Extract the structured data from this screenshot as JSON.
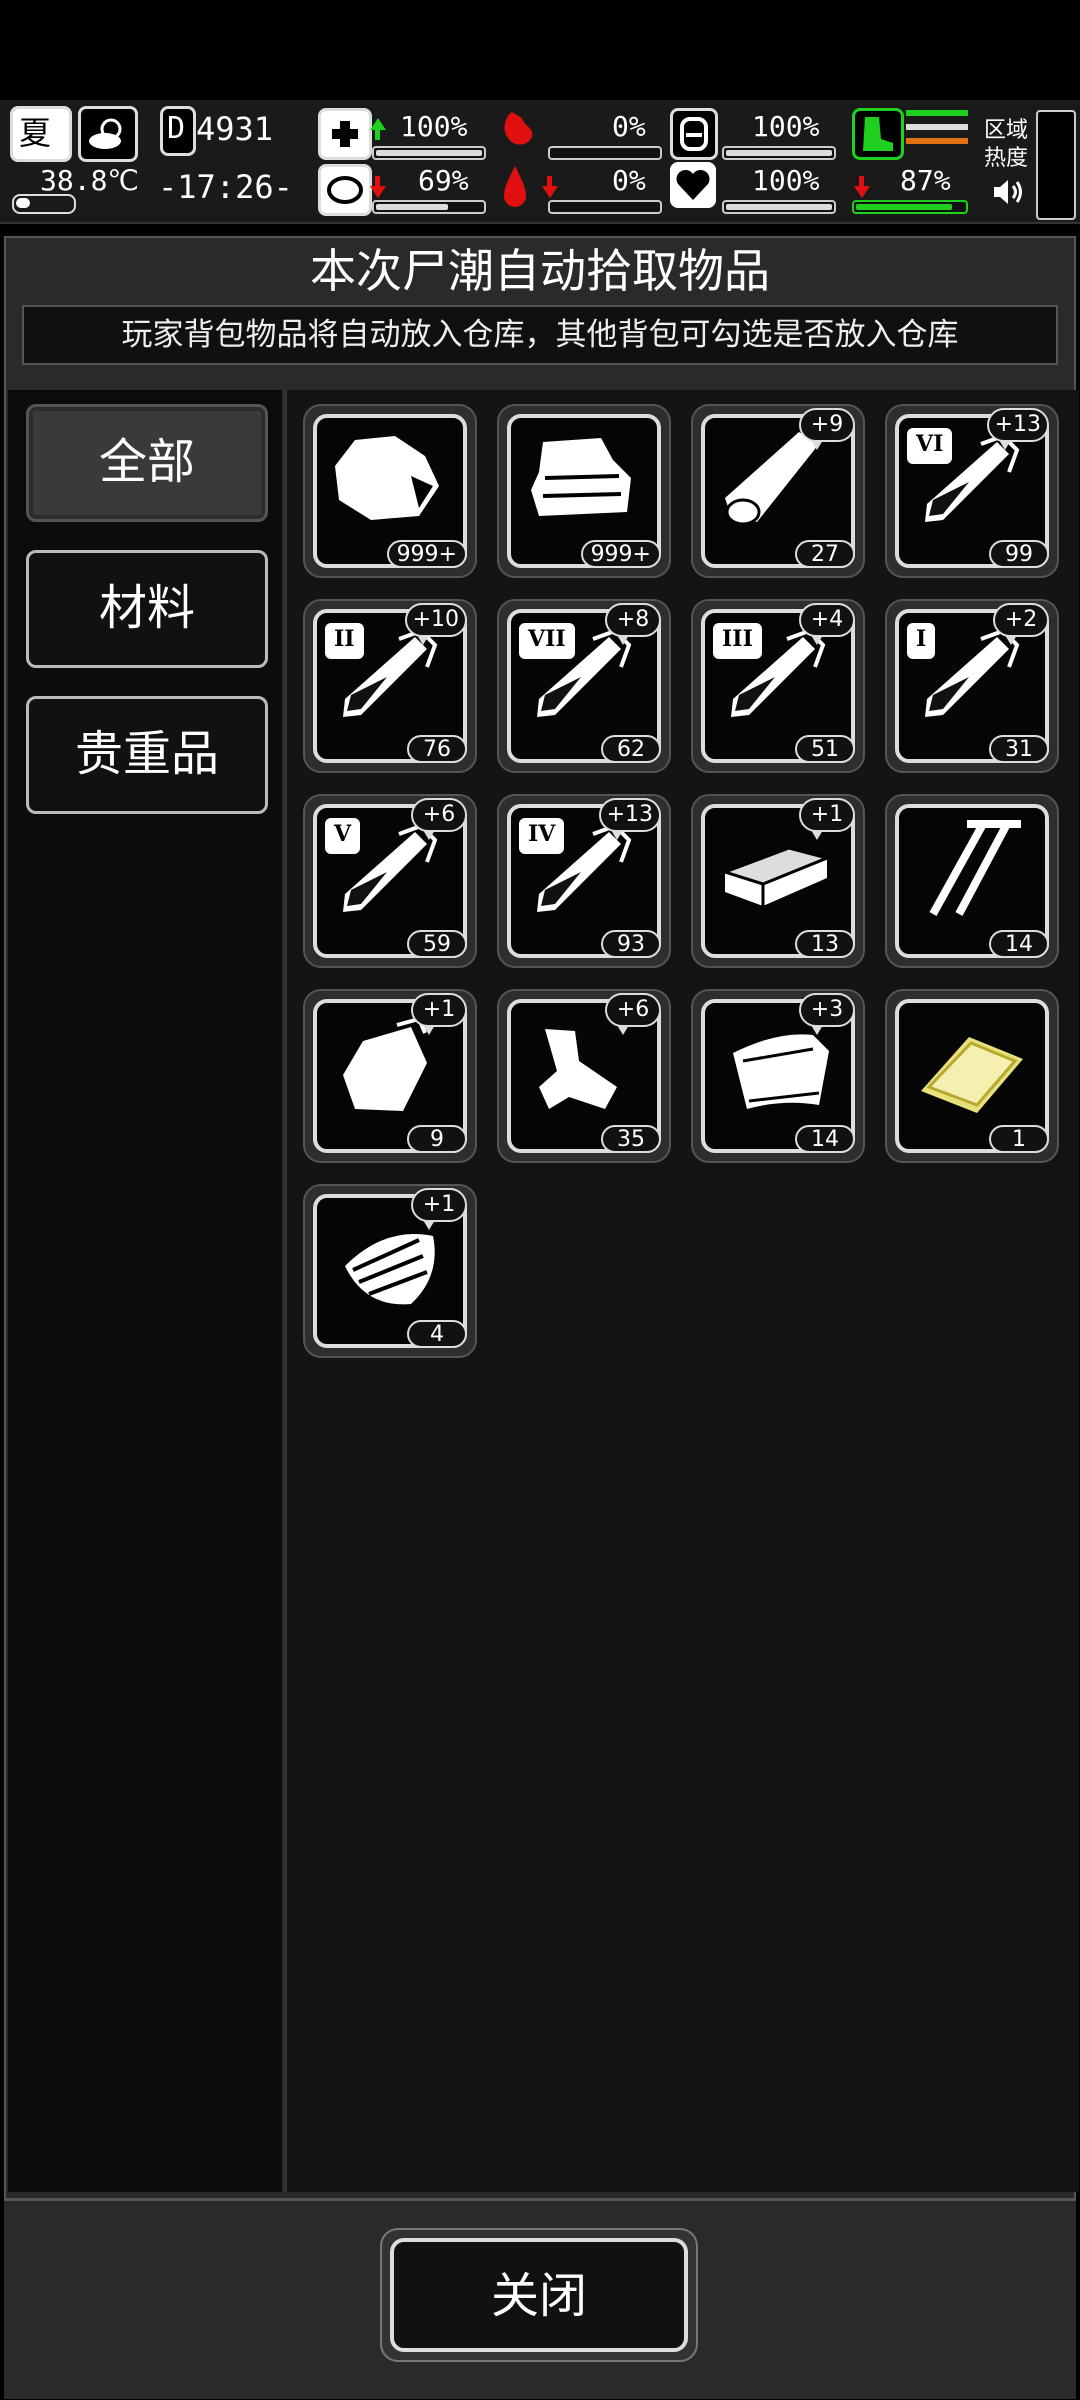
{
  "hud": {
    "season": "夏",
    "temperature": "38.8℃",
    "day": "4931",
    "time": "-17:26-",
    "stats": [
      {
        "name": "health",
        "value": "100%",
        "trend": "up",
        "fill": 1.0
      },
      {
        "name": "hunger",
        "value": "0%",
        "trend": "none",
        "fill": 0.0
      },
      {
        "name": "capacity",
        "value": "100%",
        "trend": "none",
        "fill": 1.0
      },
      {
        "name": "sanity",
        "value": "69%",
        "trend": "down",
        "fill": 0.69
      },
      {
        "name": "thirst",
        "value": "0%",
        "trend": "down",
        "fill": 0.0
      },
      {
        "name": "mood",
        "value": "100%",
        "trend": "none",
        "fill": 1.0
      },
      {
        "name": "stamina",
        "value": "87%",
        "trend": "down",
        "fill": 0.87
      }
    ],
    "area_label_1": "区域",
    "area_label_2": "热度"
  },
  "panel": {
    "title": "本次尸潮自动拾取物品",
    "subtitle": "玩家背包物品将自动放入仓库，其他背包可勾选是否放入仓库"
  },
  "tabs": [
    {
      "label": "全部",
      "active": true
    },
    {
      "label": "材料",
      "active": false
    },
    {
      "label": "贵重品",
      "active": false
    }
  ],
  "items": [
    {
      "icon": "cloth-sack-icon",
      "count": "999+",
      "bonus": "",
      "tier": ""
    },
    {
      "icon": "folded-cloth-icon",
      "count": "999+",
      "bonus": "",
      "tier": ""
    },
    {
      "icon": "wood-log-icon",
      "count": "27",
      "bonus": "+9",
      "tier": ""
    },
    {
      "icon": "test-tube-icon",
      "count": "99",
      "bonus": "+13",
      "tier": "VI"
    },
    {
      "icon": "test-tube-icon",
      "count": "76",
      "bonus": "+10",
      "tier": "II"
    },
    {
      "icon": "test-tube-icon",
      "count": "62",
      "bonus": "+8",
      "tier": "VII"
    },
    {
      "icon": "test-tube-icon",
      "count": "51",
      "bonus": "+4",
      "tier": "III"
    },
    {
      "icon": "test-tube-icon",
      "count": "31",
      "bonus": "+2",
      "tier": "I"
    },
    {
      "icon": "test-tube-icon",
      "count": "59",
      "bonus": "+6",
      "tier": "V"
    },
    {
      "icon": "test-tube-icon",
      "count": "93",
      "bonus": "+13",
      "tier": "IV"
    },
    {
      "icon": "wood-plank-icon",
      "count": "13",
      "bonus": "+1",
      "tier": ""
    },
    {
      "icon": "nails-icon",
      "count": "14",
      "bonus": "",
      "tier": ""
    },
    {
      "icon": "plastic-bag-icon",
      "count": "9",
      "bonus": "+1",
      "tier": ""
    },
    {
      "icon": "scrap-metal-icon",
      "count": "35",
      "bonus": "+6",
      "tier": ""
    },
    {
      "icon": "tarp-icon",
      "count": "14",
      "bonus": "+3",
      "tier": ""
    },
    {
      "icon": "gold-bar-icon",
      "count": "1",
      "bonus": "",
      "tier": ""
    },
    {
      "icon": "wood-shavings-icon",
      "count": "4",
      "bonus": "+1",
      "tier": ""
    }
  ],
  "close_label": "关闭"
}
